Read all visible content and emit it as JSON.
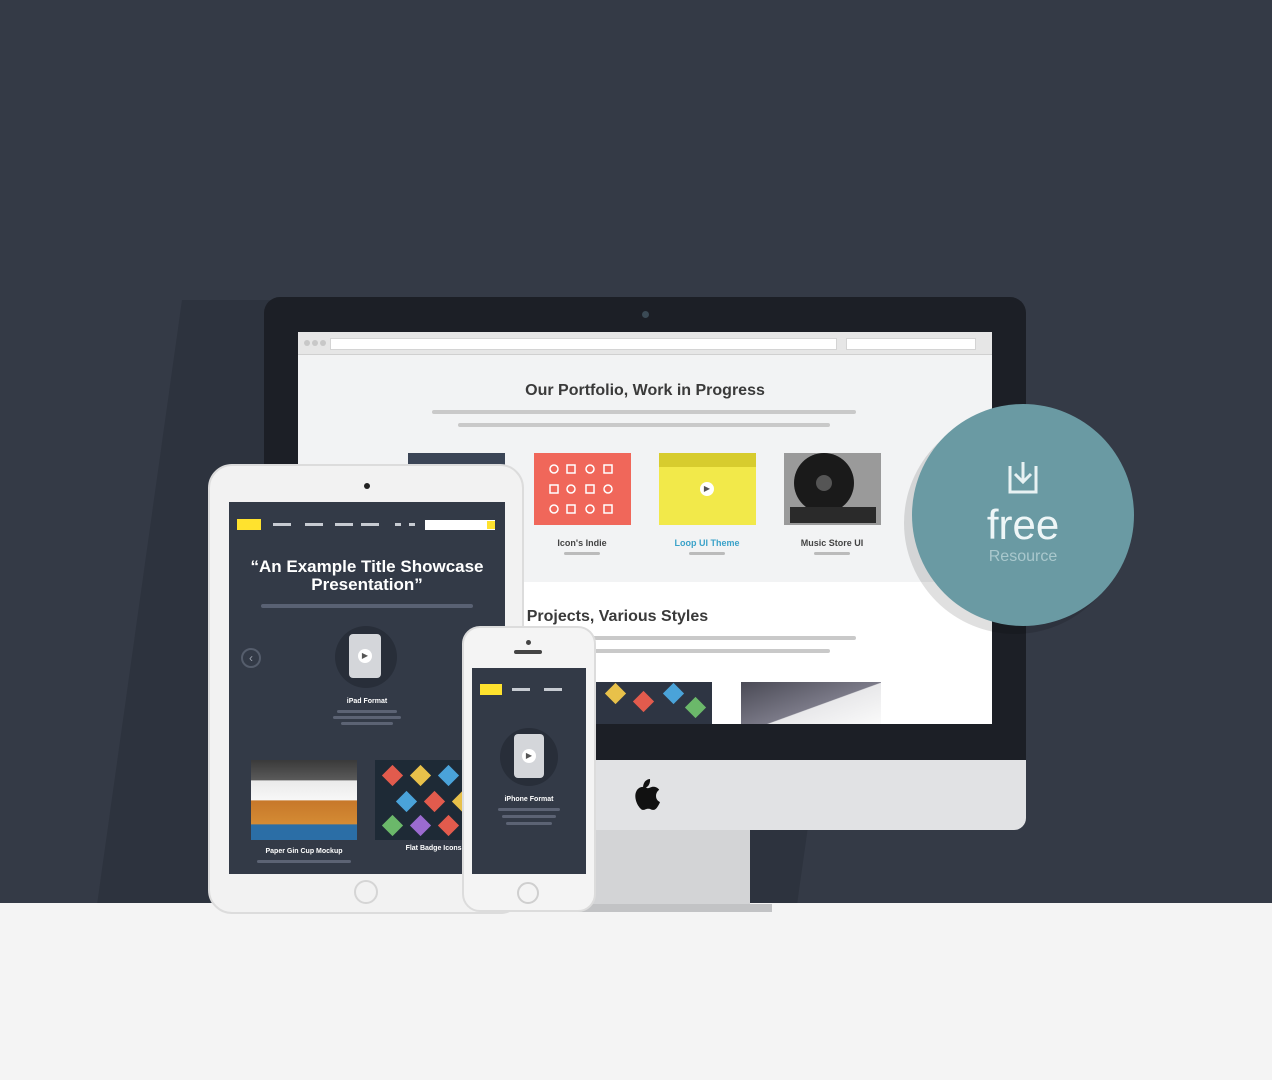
{
  "monitor": {
    "section1_title": "Our Portfolio, Work in Progress",
    "section2_title": "Our Projects, Various Styles",
    "thumbnails": [
      {
        "label": "Icon's Indie",
        "color": "#f0675a"
      },
      {
        "label": "Loop UI Theme",
        "color": "#f2e94a"
      },
      {
        "label": "Music Store UI",
        "color": "#3a3a3a"
      }
    ]
  },
  "tablet": {
    "title": "“An Example Title Showcase Presentation”",
    "device_label": "iPad Format",
    "card1_label": "Paper Gin Cup Mockup",
    "card2_label": "Flat Badge Icons Set"
  },
  "phone": {
    "device_label": "iPhone Format"
  },
  "badge": {
    "free": "free",
    "resource": "Resource",
    "color": "#6a9aa3"
  },
  "colors": {
    "background_dark": "#343a46",
    "background_light": "#f4f4f4",
    "accent_yellow": "#ffe22e"
  }
}
